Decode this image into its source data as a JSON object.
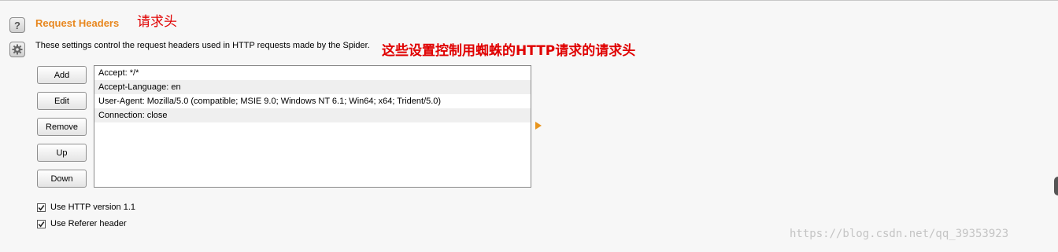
{
  "section": {
    "title": "Request Headers",
    "title_annotation": "请求头",
    "description": "These settings control the request headers used in HTTP requests made by the Spider.",
    "description_annotation": "这些设置控制用蜘蛛的HTTP请求的请求头"
  },
  "buttons": {
    "add": "Add",
    "edit": "Edit",
    "remove": "Remove",
    "up": "Up",
    "down": "Down"
  },
  "headers": [
    "Accept: */*",
    "Accept-Language: en",
    "User-Agent: Mozilla/5.0 (compatible; MSIE 9.0; Windows NT 6.1; Win64; x64; Trident/5.0)",
    "Connection: close"
  ],
  "options": [
    {
      "label": "Use HTTP version 1.1",
      "checked": true
    },
    {
      "label": "Use Referer header",
      "checked": true
    }
  ],
  "watermark": "https://blog.csdn.net/qq_39353923",
  "icons": {
    "help": "help-icon",
    "settings": "gear-icon",
    "expand": "expand-arrow-icon"
  },
  "colors": {
    "title": "#e8871e",
    "annotation": "#e00000",
    "arrow": "#e8951e"
  }
}
